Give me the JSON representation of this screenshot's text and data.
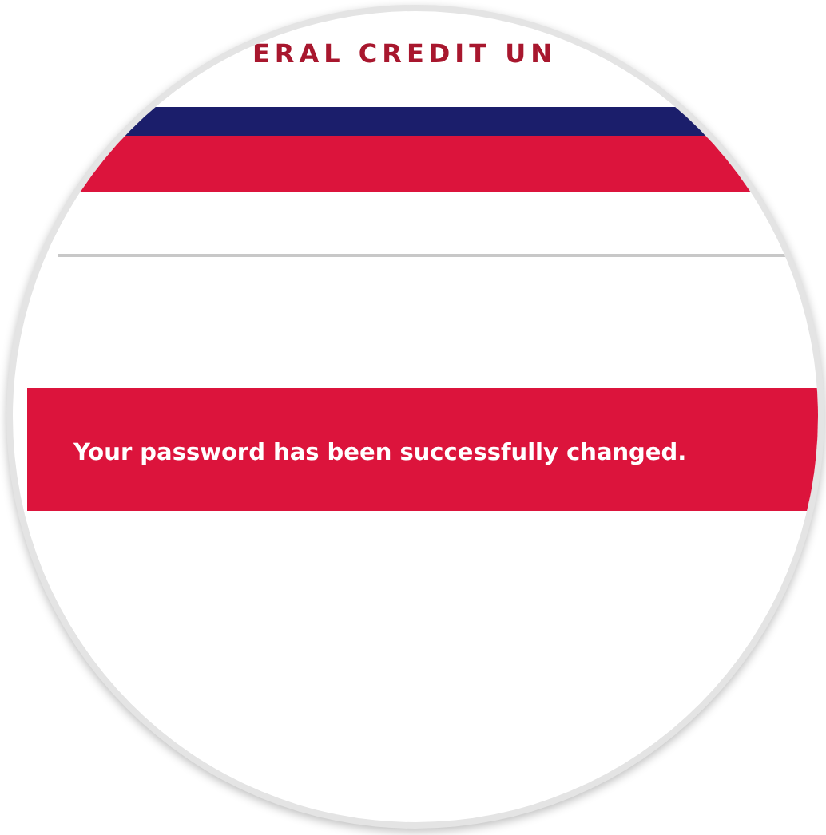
{
  "header": {
    "brand": "ERAL CREDIT UN"
  },
  "message": {
    "text": "Your password has been successfully changed."
  }
}
